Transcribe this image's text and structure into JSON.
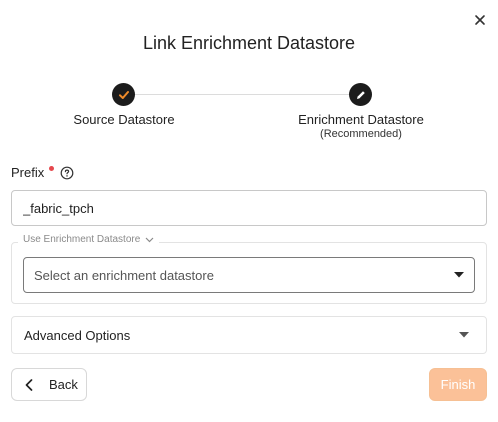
{
  "dialog": {
    "title": "Link Enrichment Datastore",
    "close_icon": "close-icon"
  },
  "stepper": {
    "steps": [
      {
        "label": "Source Datastore",
        "status": "completed",
        "icon": "check-icon"
      },
      {
        "label": "Enrichment Datastore",
        "sublabel": "(Recommended)",
        "status": "active",
        "icon": "pencil-icon"
      }
    ]
  },
  "prefix": {
    "label": "Prefix",
    "required": true,
    "help_icon": "help-circle-icon",
    "value": "_fabric_tpch"
  },
  "enrichment": {
    "legend": "Use Enrichment Datastore",
    "placeholder": "Select an enrichment datastore"
  },
  "advanced": {
    "label": "Advanced Options"
  },
  "footer": {
    "back_label": "Back",
    "finish_label": "Finish",
    "finish_disabled": true
  },
  "colors": {
    "check": "#f08c2a",
    "required": "#e5484d",
    "finish_bg": "#fbc198",
    "step_circle": "#1c1c1c"
  }
}
